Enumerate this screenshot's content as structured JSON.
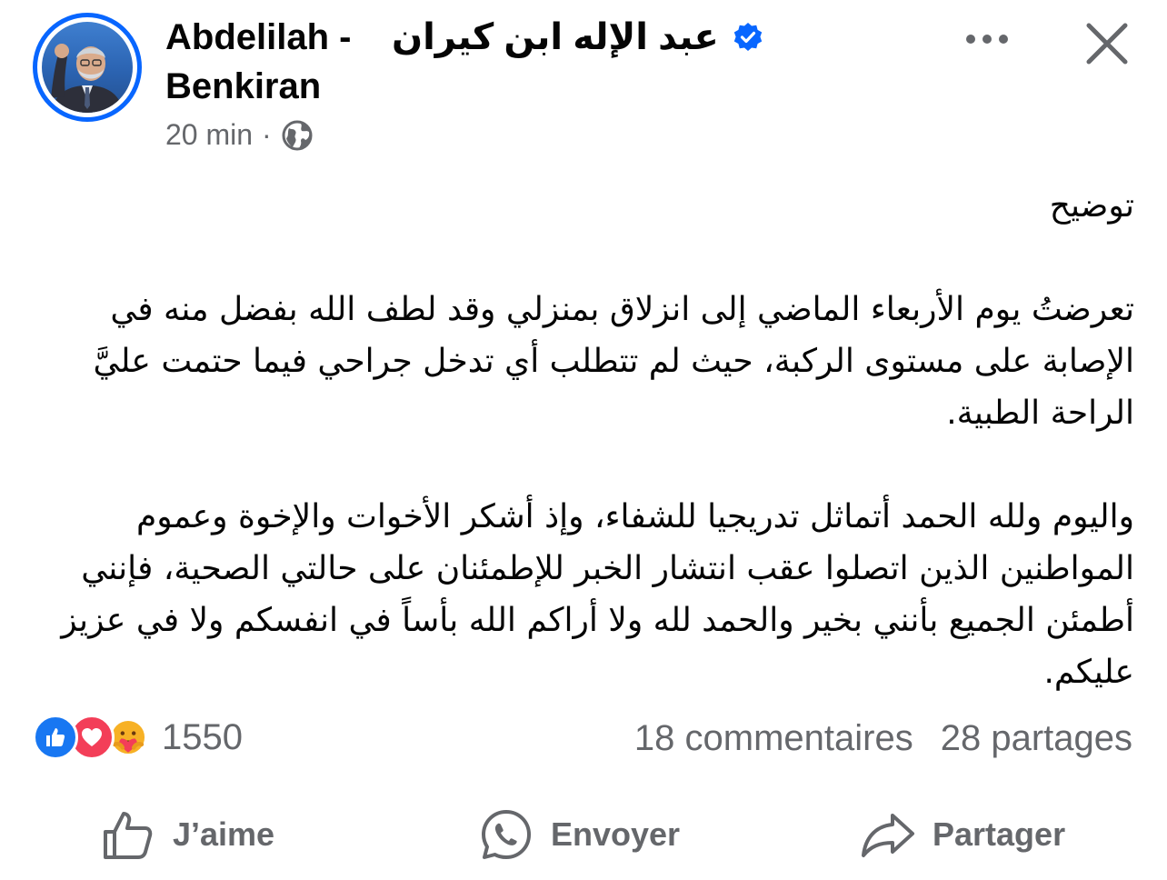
{
  "post": {
    "author": {
      "name_latin_first": "Abdelilah -",
      "name_arabic": "عبد الإله ابن كيران",
      "name_latin_last": "Benkiran"
    },
    "time": "20 min",
    "separator": "·",
    "title": "توضيح",
    "paragraphs": [
      "تعرضتُ يوم الأربعاء الماضي إلى انزلاق بمنزلي وقد لطف الله بفضل منه في الإصابة على مستوى الركبة، حيث لم تتطلب أي تدخل جراحي فيما حتمت عليَّ الراحة الطبية.",
      "واليوم ولله الحمد أتماثل تدريجيا للشفاء، وإذ أشكر الأخوات والإخوة وعموم المواطنين الذين اتصلوا عقب انتشار الخبر للإطمئنان على حالتي الصحية، فإنني أطمئن الجميع بأنني بخير والحمد لله ولا أراكم الله بأساً في انفسكم ولا في عزيز عليكم."
    ]
  },
  "reactions": {
    "count": "1550",
    "icons": [
      "like-icon",
      "love-icon",
      "care-icon"
    ]
  },
  "stats": {
    "comments": "18 commentaires",
    "shares": "28 partages"
  },
  "actions": {
    "like": "J’aime",
    "send": "Envoyer",
    "share": "Partager"
  },
  "colors": {
    "accent": "#0866ff",
    "like": "#1877f2",
    "love": "#f33e58",
    "muted": "#65676b"
  }
}
